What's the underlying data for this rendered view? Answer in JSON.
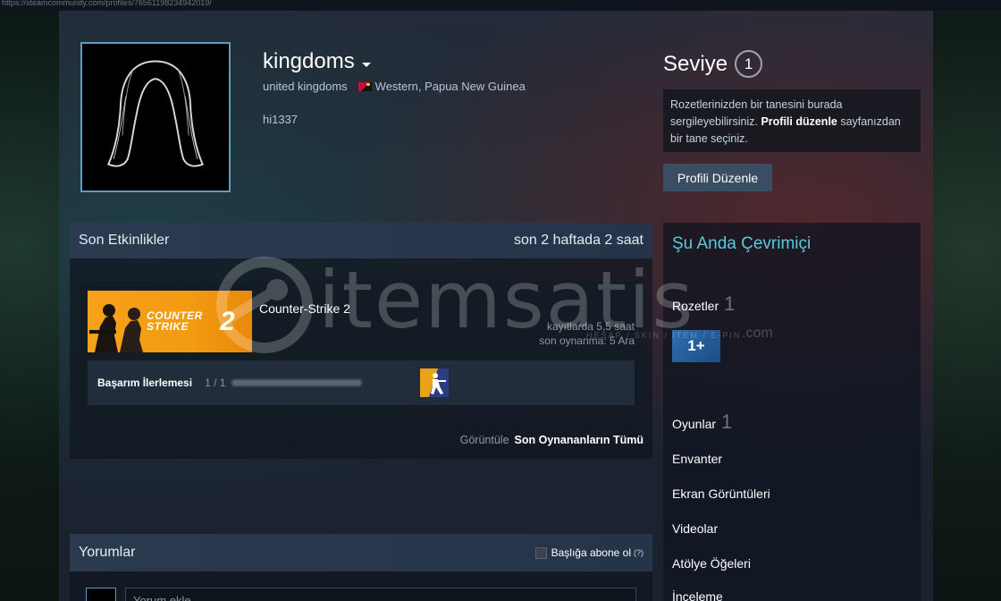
{
  "browser": {
    "url": "https://steamcommunity.com/profiles/76561198234942019/"
  },
  "profile": {
    "persona_name": "kingdoms",
    "real_name": "united kingdoms",
    "location": "Western, Papua New Guinea",
    "summary": "hi1337"
  },
  "level": {
    "label": "Seviye",
    "value": "1",
    "hint_part1": "Rozetlerinizden bir tanesini burada sergileyebilirsiniz. ",
    "hint_link": "Profili düzenle",
    "hint_part2": " sayfanızdan bir tane seçiniz.",
    "edit_button": "Profili Düzenle"
  },
  "activity": {
    "title": "Son Etkinlikler",
    "summary": "son 2 haftada 2 saat",
    "game": {
      "name": "Counter-Strike 2",
      "capsule_text_line1": "COUNTER",
      "capsule_text_line2": "STRIKE",
      "capsule_number": "2",
      "hours_on_record": "kayıtlarda 5,5 saat",
      "last_played": "son oynanma: 5 Ara"
    },
    "achievement": {
      "label": "Başarım İlerlemesi",
      "count": "1 / 1",
      "progress": 1.0
    },
    "view_all_prefix": "Görüntüle",
    "view_all_link": "Son Oynananların Tümü"
  },
  "right_column": {
    "online_status": "Şu Anda Çevrimiçi",
    "badges_label": "Rozetler",
    "badges_count": "1",
    "badge_text": "1+",
    "games_label": "Oyunlar",
    "games_count": "1",
    "inventory": "Envanter",
    "screenshots": "Ekran Görüntüleri",
    "videos": "Videolar",
    "workshop": "Atölye Öğeleri",
    "reviews": "İnceleme"
  },
  "comments": {
    "title": "Yorumlar",
    "subscribe_label": "Başlığa abone ol",
    "help": "(?)",
    "input_placeholder": "Yorum ekle"
  },
  "watermark": {
    "text": "itemsatis",
    "subtext": "HESAP / SKIN / ITEM / E-PIN",
    "suffix": ".com"
  },
  "colors": {
    "accent_online": "#57cbde",
    "avatar_border": "#5d9bc2",
    "button_bg": "#3a4d63"
  }
}
